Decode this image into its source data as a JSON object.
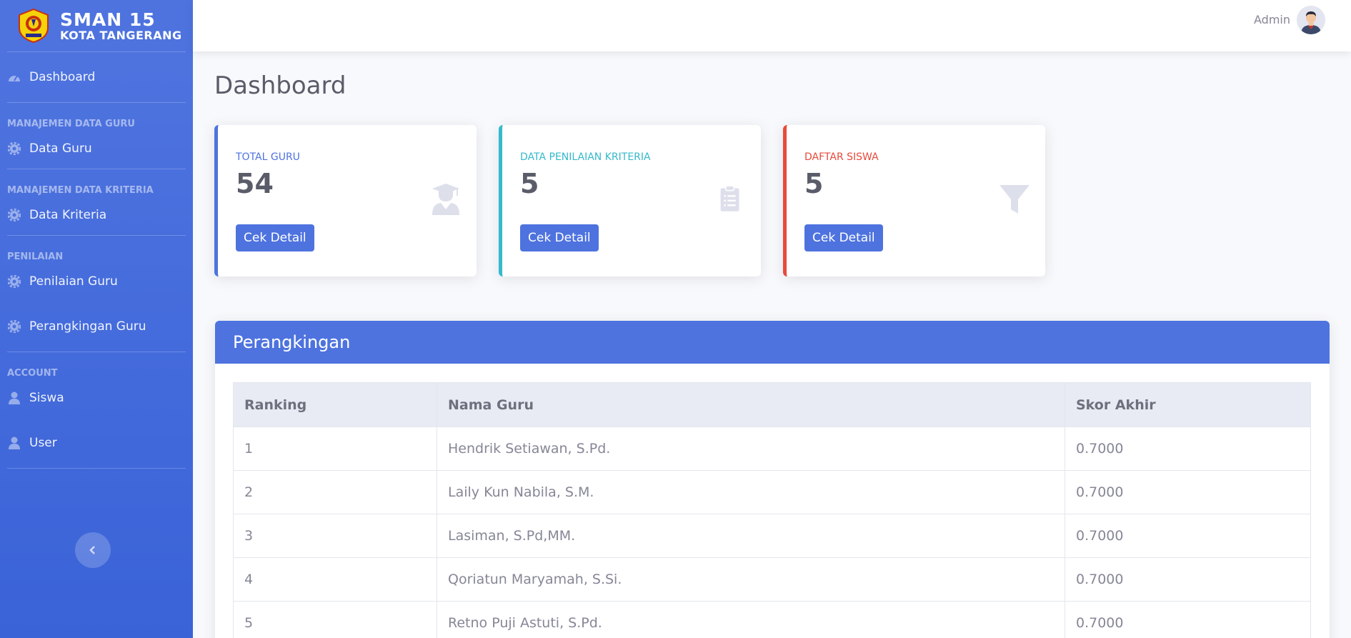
{
  "brand": {
    "line1": "SMAN 15",
    "line2": "KOTA TANGERANG"
  },
  "sidebar": {
    "dashboard": {
      "label": "Dashboard",
      "icon": "tachometer-icon"
    },
    "headings": {
      "guru": "MANAJEMEN DATA GURU",
      "kriteria": "MANAJEMEN DATA KRITERIA",
      "penilaian": "PENILAIAN",
      "account": "ACCOUNT"
    },
    "items": {
      "data_guru": "Data Guru",
      "data_kriteria": "Data Kriteria",
      "penilaian_guru": "Penilaian Guru",
      "perangkingan_guru": "Perangkingan Guru",
      "siswa": "Siswa",
      "user": "User"
    }
  },
  "topbar": {
    "user_name": "Admin"
  },
  "page": {
    "title": "Dashboard"
  },
  "cards": [
    {
      "label": "TOTAL GURU",
      "value": "54",
      "button": "Cek Detail",
      "color": "#4e73df",
      "icon": "user-graduate-icon"
    },
    {
      "label": "DATA PENILAIAN KRITERIA",
      "value": "5",
      "button": "Cek Detail",
      "color": "#36b9cc",
      "icon": "clipboard-list-icon"
    },
    {
      "label": "DAFTAR SISWA",
      "value": "5",
      "button": "Cek Detail",
      "color": "#e74a3b",
      "icon": "filter-icon"
    }
  ],
  "ranking": {
    "title": "Perangkingan",
    "columns": [
      "Ranking",
      "Nama Guru",
      "Skor Akhir"
    ],
    "rows": [
      [
        "1",
        "Hendrik Setiawan, S.Pd.",
        "0.7000"
      ],
      [
        "2",
        "Laily Kun Nabila, S.M.",
        "0.7000"
      ],
      [
        "3",
        "Lasiman, S.Pd,MM.",
        "0.7000"
      ],
      [
        "4",
        "Qoriatun Maryamah, S.Si.",
        "0.7000"
      ],
      [
        "5",
        "Retno Puji Astuti, S.Pd.",
        "0.7000"
      ]
    ]
  }
}
